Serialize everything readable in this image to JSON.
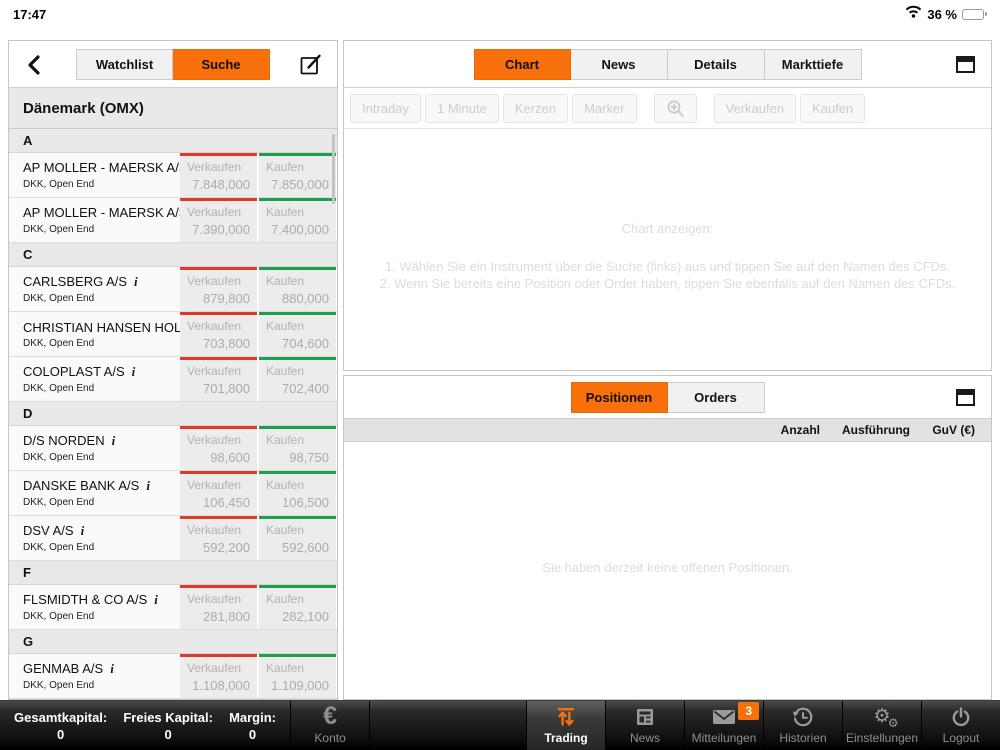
{
  "colors": {
    "accent": "#f7700b",
    "sell_red": "#dd3a2b",
    "buy_green": "#1ea04a"
  },
  "status_bar": {
    "time": "17:47",
    "battery_percent": "36 %"
  },
  "left_panel": {
    "tabs": [
      {
        "label": "Watchlist",
        "active": false
      },
      {
        "label": "Suche",
        "active": true
      }
    ],
    "region_header": "Dänemark (OMX)",
    "sell_label": "Verkaufen",
    "buy_label": "Kaufen",
    "sections": [
      {
        "letter": "A",
        "rows": [
          {
            "name": "AP MOLLER - MAERSK A/S",
            "has_info": true,
            "subtitle": "DKK, Open End",
            "sell": "7.848,000",
            "buy": "7.850,000"
          },
          {
            "name": "AP MOLLER - MAERSK A/S - A",
            "has_info": true,
            "subtitle": "DKK, Open End",
            "sell": "7.390,000",
            "buy": "7.400,000"
          }
        ]
      },
      {
        "letter": "C",
        "rows": [
          {
            "name": "CARLSBERG A/S",
            "has_info": true,
            "subtitle": "DKK, Open End",
            "sell": "879,800",
            "buy": "880,000"
          },
          {
            "name": "CHRISTIAN HANSEN HOLDING...",
            "has_info": false,
            "subtitle": "DKK, Open End",
            "sell": "703,800",
            "buy": "704,600"
          },
          {
            "name": "COLOPLAST A/S",
            "has_info": true,
            "subtitle": "DKK, Open End",
            "sell": "701,800",
            "buy": "702,400"
          }
        ]
      },
      {
        "letter": "D",
        "rows": [
          {
            "name": "D/S NORDEN",
            "has_info": true,
            "subtitle": "DKK, Open End",
            "sell": "98,600",
            "buy": "98,750"
          },
          {
            "name": "DANSKE BANK A/S",
            "has_info": true,
            "subtitle": "DKK, Open End",
            "sell": "106,450",
            "buy": "106,500"
          },
          {
            "name": "DSV A/S",
            "has_info": true,
            "subtitle": "DKK, Open End",
            "sell": "592,200",
            "buy": "592,600"
          }
        ]
      },
      {
        "letter": "F",
        "rows": [
          {
            "name": "FLSMIDTH & CO A/S",
            "has_info": true,
            "subtitle": "DKK, Open End",
            "sell": "281,800",
            "buy": "282,100"
          }
        ]
      },
      {
        "letter": "G",
        "rows": [
          {
            "name": "GENMAB A/S",
            "has_info": true,
            "subtitle": "DKK, Open End",
            "sell": "1.108,000",
            "buy": "1.109,000"
          }
        ]
      }
    ]
  },
  "chart_panel": {
    "tabs": [
      {
        "label": "Chart",
        "active": true
      },
      {
        "label": "News",
        "active": false
      },
      {
        "label": "Details",
        "active": false
      },
      {
        "label": "Markttiefe",
        "active": false
      }
    ],
    "toolbar": [
      {
        "label": "Intraday"
      },
      {
        "label": "1 Minute"
      },
      {
        "label": "Kerzen"
      },
      {
        "label": "Marker"
      },
      {
        "icon": "zoom-in-icon",
        "gap": true
      },
      {
        "label": "Verkaufen",
        "gap": true
      },
      {
        "label": "Kaufen"
      }
    ],
    "placeholder": {
      "title": "Chart anzeigen:",
      "instructions": [
        "1. Wählen Sie ein Instrument über die Suche (links) aus und tippen Sie auf den Namen des CFDs.",
        "2. Wenn Sie bereits eine Position oder Order haben, tippen Sie ebenfalls auf den Namen des CFDs."
      ]
    }
  },
  "positions_panel": {
    "tabs": [
      {
        "label": "Positionen",
        "active": true
      },
      {
        "label": "Orders",
        "active": false
      }
    ],
    "columns": [
      "Anzahl",
      "Ausführung",
      "GuV (€)"
    ],
    "empty_text": "Sie haben derzeit keine offenen Positionen."
  },
  "bottom_bar": {
    "stats": [
      {
        "label": "Gesamtkapital:",
        "value": "0"
      },
      {
        "label": "Freies Kapital:",
        "value": "0"
      },
      {
        "label": "Margin:",
        "value": "0"
      }
    ],
    "nav": [
      {
        "label": "Konto",
        "icon": "euro-icon",
        "active": false
      },
      {
        "label": "Trading",
        "icon": "trading-icon",
        "active": true
      },
      {
        "label": "News",
        "icon": "news-icon",
        "active": false
      },
      {
        "label": "Mitteilungen",
        "icon": "mail-icon",
        "badge": "3",
        "active": false
      },
      {
        "label": "Historien",
        "icon": "history-icon",
        "active": false
      },
      {
        "label": "Einstellungen",
        "icon": "settings-icon",
        "active": false
      },
      {
        "label": "Logout",
        "icon": "logout-icon",
        "active": false
      }
    ]
  }
}
